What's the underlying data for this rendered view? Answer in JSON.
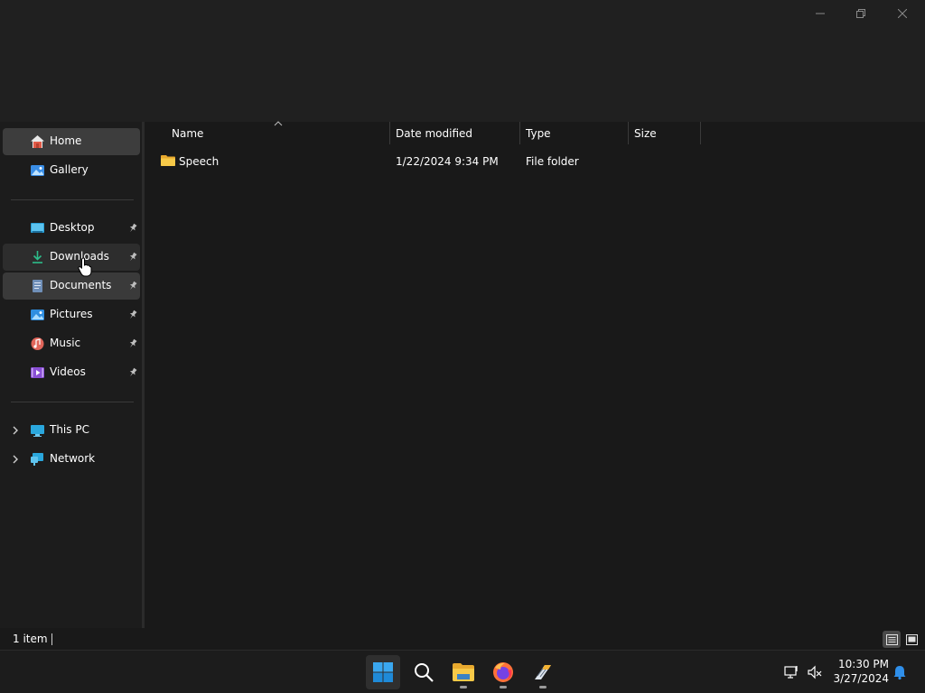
{
  "window": {
    "controls": {
      "minimize_icon": "minimize-icon",
      "maximize_icon": "restore-icon",
      "close_icon": "close-icon"
    }
  },
  "sidebar": {
    "top_items": [
      {
        "label": "Home",
        "icon": "home-icon"
      },
      {
        "label": "Gallery",
        "icon": "gallery-icon"
      }
    ],
    "pinned_items": [
      {
        "label": "Desktop",
        "icon": "desktop-icon"
      },
      {
        "label": "Downloads",
        "icon": "download-icon"
      },
      {
        "label": "Documents",
        "icon": "documents-icon"
      },
      {
        "label": "Pictures",
        "icon": "pictures-icon"
      },
      {
        "label": "Music",
        "icon": "music-icon"
      },
      {
        "label": "Videos",
        "icon": "videos-icon"
      }
    ],
    "tree_items": [
      {
        "label": "This PC",
        "icon": "this-pc-icon"
      },
      {
        "label": "Network",
        "icon": "network-icon"
      }
    ]
  },
  "columns": {
    "name": "Name",
    "date_modified": "Date modified",
    "type": "Type",
    "size": "Size"
  },
  "files": [
    {
      "name": "Speech",
      "date_modified": "1/22/2024 9:34 PM",
      "type": "File folder",
      "size": ""
    }
  ],
  "status": {
    "item_count": "1 item"
  },
  "taskbar": {
    "apps": [
      "start-icon",
      "search-icon",
      "file-explorer-icon",
      "firefox-icon",
      "app-icon"
    ],
    "clock": {
      "time": "10:30 PM",
      "date": "3/27/2024"
    }
  },
  "colors": {
    "background": "#191919",
    "chrome": "#202020",
    "selection": "#3d3d3d",
    "folder": "#f2c14e",
    "accent": "#0078d4"
  }
}
